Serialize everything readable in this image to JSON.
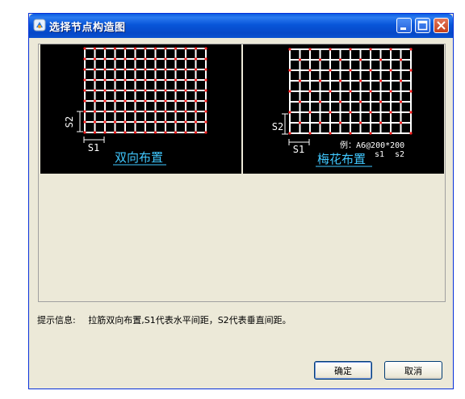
{
  "window": {
    "title": "选择节点构造图"
  },
  "options": [
    {
      "label": "双向布置",
      "dim_x": "S1",
      "dim_y": "S2",
      "selected": true,
      "example": "",
      "example_s1": "",
      "example_s2": ""
    },
    {
      "label": "梅花布置",
      "dim_x": "S1",
      "dim_y": "S2",
      "selected": false,
      "example": "例：A6@200*200",
      "example_s1": "s1",
      "example_s2": "s2"
    }
  ],
  "hint": {
    "label": "提示信息:",
    "text": "拉筋双向布置,S1代表水平间距，S2代表垂直间距。"
  },
  "buttons": {
    "ok": "确定",
    "cancel": "取消"
  },
  "colors": {
    "grid": "#ffffff",
    "node": "#ff2020",
    "label": "#40c8ff",
    "selection": "#ff1a1a"
  }
}
